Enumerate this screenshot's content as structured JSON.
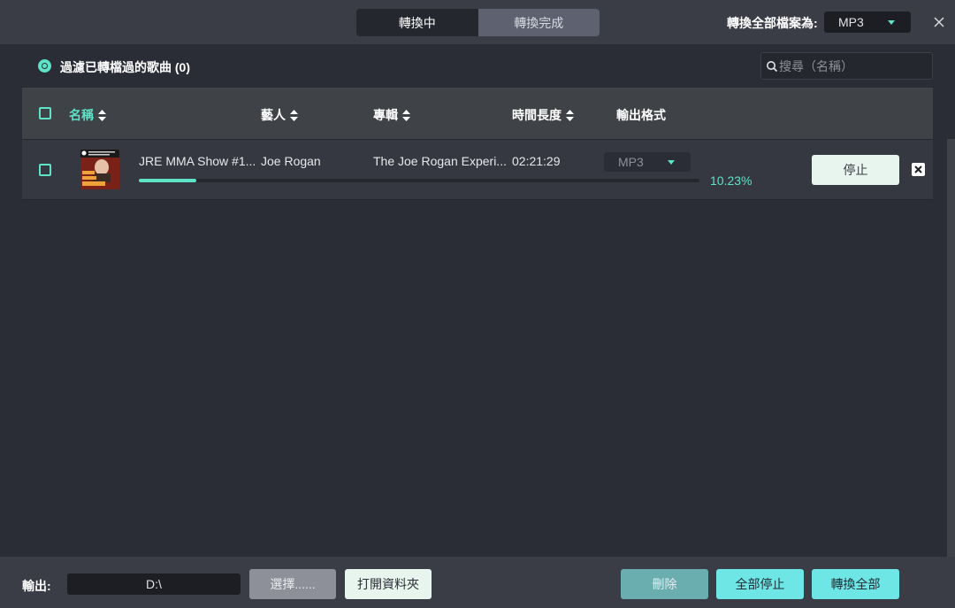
{
  "header": {
    "tabs": [
      {
        "label": "轉換中",
        "active": true
      },
      {
        "label": "轉換完成",
        "active": false
      }
    ],
    "convert_all_as_label": "轉換全部檔案為:",
    "convert_all_format": "MP3",
    "close_icon": "close-icon"
  },
  "filter": {
    "label": "過濾已轉檔過的歌曲 (0)",
    "checked": true
  },
  "search": {
    "placeholder": "搜尋（名稱）",
    "value": ""
  },
  "table": {
    "columns": {
      "name": "名稱",
      "artist": "藝人",
      "album": "專輯",
      "duration": "時間長度",
      "format": "輸出格式"
    },
    "rows": [
      {
        "title": "JRE MMA Show #1...",
        "artist": "Joe Rogan",
        "album": "The Joe Rogan Experi...",
        "duration": "02:21:29",
        "format": "MP3",
        "progress_percent": 10.23,
        "progress_label": "10.23%",
        "action_label": "停止",
        "thumb_text": "#143 SEAN STRICKLAND"
      }
    ]
  },
  "footer": {
    "output_label": "輸出:",
    "output_path": "D:\\",
    "choose_label": "選擇......",
    "open_folder_label": "打開資料夾",
    "delete_label": "刪除",
    "stop_all_label": "全部停止",
    "convert_all_label": "轉換全部"
  },
  "colors": {
    "accent": "#5ee2c8",
    "background": "#2a2d35",
    "header_bg": "#3a3d46"
  }
}
